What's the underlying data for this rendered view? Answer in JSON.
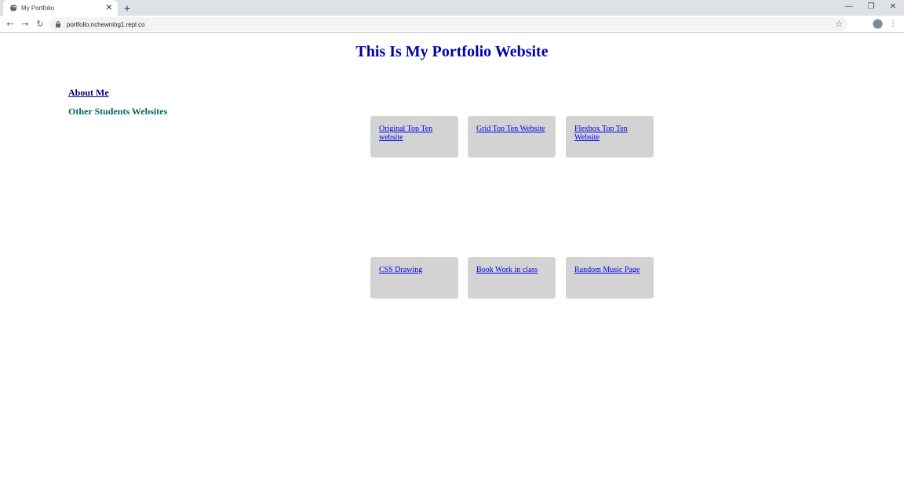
{
  "browser": {
    "tab_title": "My Portfolio",
    "tab_close": "✕",
    "new_tab": "+",
    "url": "portfolio.nchewning1.repl.co",
    "window_controls": {
      "minimize": "—",
      "maximize": "❐",
      "close": "✕"
    },
    "nav": {
      "back": "←",
      "forward": "→",
      "reload": "↻"
    },
    "star": "☆",
    "menu": "⋮"
  },
  "page": {
    "title": "This Is My Portfolio Website",
    "about_link": "About Me",
    "students_heading": "Other Students Websites",
    "cards": [
      {
        "label": "Original Top Ten website"
      },
      {
        "label": "Grid Top Ten Website"
      },
      {
        "label": "Flexbox Top Ten Website"
      },
      {
        "label": "CSS Drawing"
      },
      {
        "label": "Book Work in class"
      },
      {
        "label": "Random Music Page"
      }
    ]
  },
  "colors": {
    "title": "#0000a6",
    "students_heading": "#006666",
    "card_bg": "#d3d3d3",
    "link": "#0000ee"
  }
}
